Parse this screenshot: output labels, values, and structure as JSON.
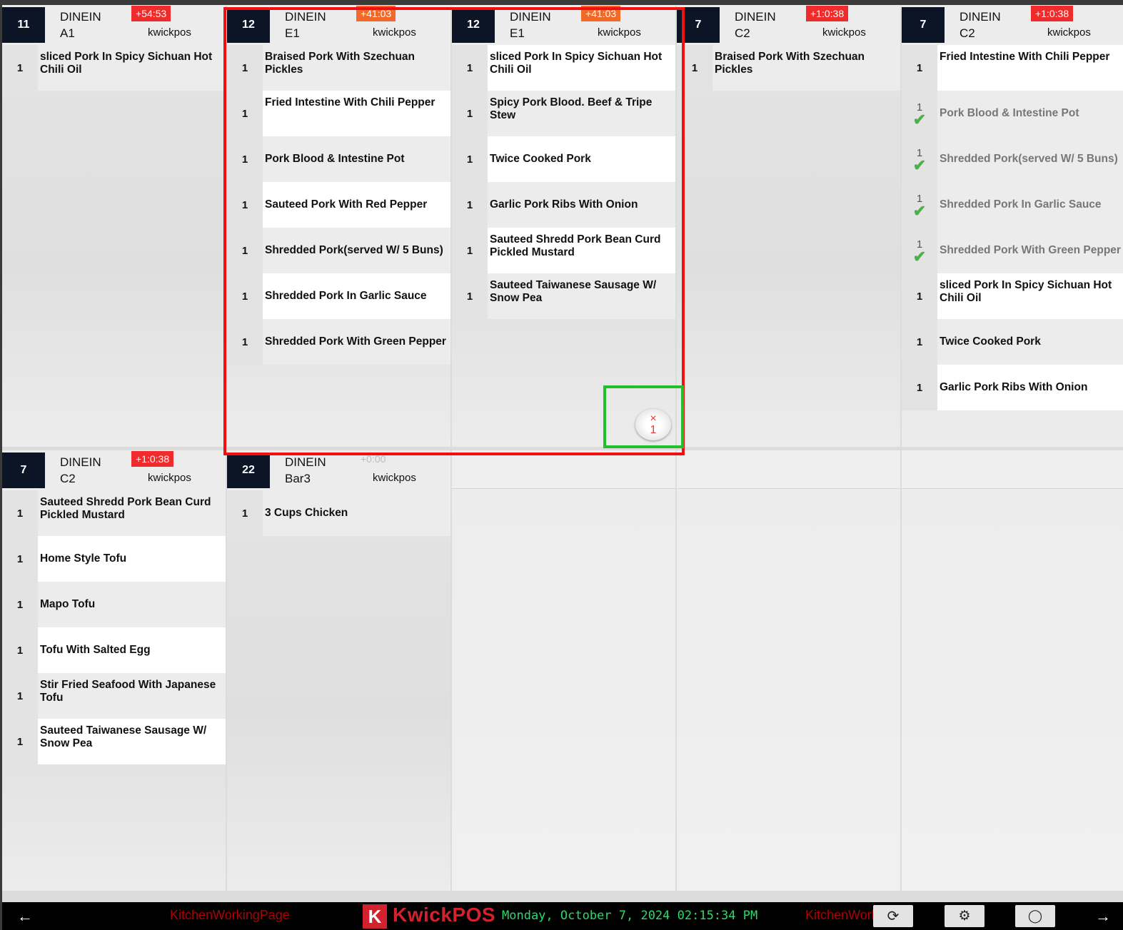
{
  "tickets": [
    {
      "number": "11",
      "type": "DINEIN",
      "table": "A1",
      "time": "+54:53",
      "time_style": "red",
      "user": "kwickpos",
      "items": [
        {
          "qty": "1",
          "name": "sliced Pork In Spicy Sichuan Hot Chili Oil",
          "alt": false,
          "done": false
        }
      ]
    },
    {
      "number": "12",
      "type": "DINEIN",
      "table": "E1",
      "time": "+41:03",
      "time_style": "orange",
      "user": "kwickpos",
      "items": [
        {
          "qty": "1",
          "name": "Braised Pork With Szechuan Pickles",
          "alt": false,
          "done": false
        },
        {
          "qty": "1",
          "name": "Fried Intestine With Chili Pepper",
          "alt": true,
          "done": false
        },
        {
          "qty": "1",
          "name": "Pork Blood & Intestine Pot",
          "alt": false,
          "done": false
        },
        {
          "qty": "1",
          "name": "Sauteed Pork With Red Pepper",
          "alt": true,
          "done": false
        },
        {
          "qty": "1",
          "name": "Shredded Pork(served W/ 5 Buns)",
          "alt": false,
          "done": false
        },
        {
          "qty": "1",
          "name": "Shredded Pork In Garlic Sauce",
          "alt": true,
          "done": false
        },
        {
          "qty": "1",
          "name": "Shredded Pork With Green Pepper",
          "alt": false,
          "done": false
        }
      ]
    },
    {
      "number": "12",
      "type": "DINEIN",
      "table": "E1",
      "time": "+41:03",
      "time_style": "orange",
      "user": "kwickpos",
      "items": [
        {
          "qty": "1",
          "name": "sliced Pork In Spicy Sichuan Hot Chili Oil",
          "alt": true,
          "done": false
        },
        {
          "qty": "1",
          "name": "Spicy Pork Blood. Beef & Tripe Stew",
          "alt": false,
          "done": false
        },
        {
          "qty": "1",
          "name": "Twice Cooked Pork",
          "alt": true,
          "done": false
        },
        {
          "qty": "1",
          "name": "Garlic Pork Ribs With Onion",
          "alt": false,
          "done": false
        },
        {
          "qty": "1",
          "name": "Sauteed Shredd Pork Bean Curd Pickled Mustard",
          "alt": true,
          "done": false
        },
        {
          "qty": "1",
          "name": "Sauteed Taiwanese Sausage W/ Snow Pea",
          "alt": false,
          "done": false
        }
      ]
    },
    {
      "number": "7",
      "type": "DINEIN",
      "table": "C2",
      "time": "+1:0:38",
      "time_style": "red",
      "user": "kwickpos",
      "items": [
        {
          "qty": "1",
          "name": "Braised Pork With Szechuan Pickles",
          "alt": false,
          "done": false
        }
      ]
    },
    {
      "number": "7",
      "type": "DINEIN",
      "table": "C2",
      "time": "+1:0:38",
      "time_style": "red",
      "user": "kwickpos",
      "items": [
        {
          "qty": "1",
          "name": "Fried Intestine With Chili Pepper",
          "alt": true,
          "done": false
        },
        {
          "qty": "1",
          "name": "Pork Blood & Intestine Pot",
          "alt": false,
          "done": true
        },
        {
          "qty": "1",
          "name": "Shredded Pork(served W/ 5 Buns)",
          "alt": false,
          "done": true
        },
        {
          "qty": "1",
          "name": "Shredded Pork In Garlic Sauce",
          "alt": false,
          "done": true
        },
        {
          "qty": "1",
          "name": "Shredded Pork With Green Pepper",
          "alt": false,
          "done": true
        },
        {
          "qty": "1",
          "name": "sliced Pork In Spicy Sichuan Hot Chili Oil",
          "alt": true,
          "done": false
        },
        {
          "qty": "1",
          "name": "Twice Cooked Pork",
          "alt": false,
          "done": false
        },
        {
          "qty": "1",
          "name": "Garlic Pork Ribs With Onion",
          "alt": true,
          "done": false
        }
      ]
    },
    {
      "number": "7",
      "type": "DINEIN",
      "table": "C2",
      "time": "+1:0:38",
      "time_style": "red",
      "user": "kwickpos",
      "items": [
        {
          "qty": "1",
          "name": "Sauteed Shredd Pork Bean Curd Pickled Mustard",
          "alt": false,
          "done": false
        },
        {
          "qty": "1",
          "name": "Home Style Tofu",
          "alt": true,
          "done": false
        },
        {
          "qty": "1",
          "name": "Mapo Tofu",
          "alt": false,
          "done": false
        },
        {
          "qty": "1",
          "name": "Tofu With Salted Egg",
          "alt": true,
          "done": false
        },
        {
          "qty": "1",
          "name": "Stir Fried Seafood With Japanese Tofu",
          "alt": false,
          "done": false
        },
        {
          "qty": "1",
          "name": "Sauteed Taiwanese Sausage W/ Snow Pea",
          "alt": true,
          "done": false
        }
      ]
    },
    {
      "number": "22",
      "type": "DINEIN",
      "table": "Bar3",
      "time": "+0:00",
      "time_style": "faint",
      "user": "kwickpos",
      "items": [
        {
          "qty": "1",
          "name": "3 Cups Chicken",
          "alt": false,
          "done": false
        }
      ]
    }
  ],
  "badge": {
    "icon": "close-x-icon",
    "symbol": "×",
    "count": "1"
  },
  "footer": {
    "left_arrow": "←",
    "ghost_left": "KitchenWorkingPage",
    "logo_letter": "K",
    "logo_text": "KwickPOS",
    "datetime": "Monday, October 7, 2024 02:15:34 PM",
    "ghost_right": "KitchenWork",
    "refresh_symbol": "⟳",
    "settings_symbol": "⚙",
    "toggle_symbol": "◯",
    "right_arrow": "→"
  },
  "colors": {
    "header_dark": "#0c1526",
    "time_red": "#ef2b2b",
    "time_orange": "#f26a2a",
    "logo_red": "#d3212d",
    "clock_green": "#2bd96b",
    "check_green": "#4caf50",
    "highlight_red": "#f01010",
    "highlight_green": "#22c02a"
  }
}
